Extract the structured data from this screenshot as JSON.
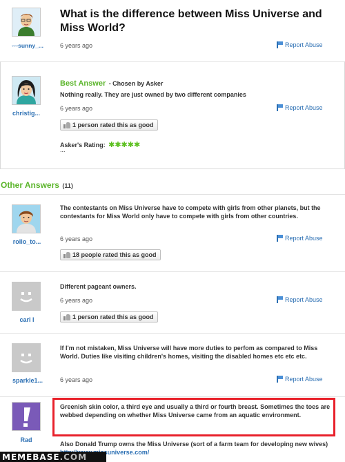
{
  "question": {
    "title": "What is the difference between Miss Universe and Miss World?",
    "asker": "◦◦◦sunny_...",
    "time": "6 years ago",
    "report": "Report Abuse"
  },
  "best_answer": {
    "heading": "Best Answer",
    "chosen": "- Chosen by Asker",
    "text": "Nothing really. They are just owned by two different companies",
    "user": "christig...",
    "time": "6 years ago",
    "report": "Report Abuse",
    "rated": "1 person rated this as good",
    "askers_rating_label": "Asker's Rating:",
    "stars": "✱✱✱✱✱",
    "ellipsis": "..."
  },
  "other_answers": {
    "heading": "Other Answers",
    "count": "(11)"
  },
  "answers": [
    {
      "user": "rollo_to...",
      "text": "The contestants on Miss Universe have to compete with girls from other planets, but the contestants for Miss World only have to compete with girls from other countries.",
      "time": "6 years ago",
      "report": "Report Abuse",
      "rated": "18 people rated this as good"
    },
    {
      "user": "carl l",
      "text": "Different pageant owners.",
      "time": "6 years ago",
      "report": "Report Abuse",
      "rated": "1 person rated this as good"
    },
    {
      "user": "sparkle1...",
      "text": "If I'm not mistaken, Miss Universe will have more duties to perfom as compared to Miss World. Duties like visiting children's homes, visiting the disabled homes etc etc etc.",
      "time": "6 years ago",
      "report": "Report Abuse"
    },
    {
      "user": "Rad",
      "text": "Greenish skin color, a third eye and usually a third or fourth breast. Sometimes the toes are webbed depending on whether Miss Universe came from an aquatic environment.",
      "text2": "Also Donald Trump owns the Miss Universe (sort of a farm team for developing new wives)",
      "link": "http://www.missuniverse.com/"
    }
  ],
  "watermark": {
    "left": "MEMEBASE",
    "right": ".COM"
  },
  "colors": {
    "link_blue": "#2b6fb3",
    "green": "#5bb52b",
    "highlight_red": "#e8202a",
    "star_green": "#5bbf1e"
  }
}
